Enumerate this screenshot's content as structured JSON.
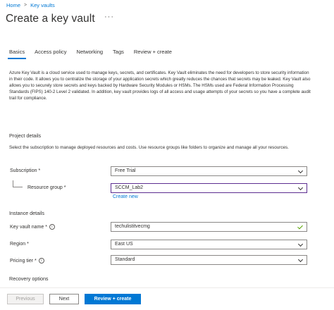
{
  "breadcrumb": {
    "home": "Home",
    "separator": ">",
    "parent": "Key vaults"
  },
  "page": {
    "title": "Create a key vault",
    "more": "···"
  },
  "tabs": [
    {
      "label": "Basics",
      "active": true
    },
    {
      "label": "Access policy",
      "active": false
    },
    {
      "label": "Networking",
      "active": false
    },
    {
      "label": "Tags",
      "active": false
    },
    {
      "label": "Review + create",
      "active": false
    }
  ],
  "intro": "Azure Key Vault is a cloud service used to manage keys, secrets, and certificates. Key Vault eliminates the need for developers to store security information in their code. It allows you to centralize the storage of your application secrets which greatly reduces the chances that secrets may be leaked. Key Vault also allows you to securely store secrets and keys backed by Hardware Security Modules or HSMs. The HSMs used are Federal Information Processing Standards (FIPS) 140-2 Level 2 validated. In addition, key vault provides logs of all access and usage attempts of your secrets so you have a complete audit trail for compliance.",
  "project": {
    "heading": "Project details",
    "description": "Select the subscription to manage deployed resources and costs. Use resource groups like folders to organize and manage all your resources.",
    "subscription": {
      "label": "Subscription *",
      "value": "Free Trial"
    },
    "resource_group": {
      "label": "Resource group *",
      "value": "SCCM_Lab2",
      "create_new": "Create new"
    }
  },
  "instance": {
    "heading": "Instance details",
    "name": {
      "label": "Key vault name *",
      "value": "techulistitvecmg"
    },
    "region": {
      "label": "Region *",
      "value": "East US"
    },
    "pricing": {
      "label": "Pricing tier *",
      "value": "Standard"
    }
  },
  "recovery": {
    "heading": "Recovery options"
  },
  "footer": {
    "previous": "Previous",
    "next": "Next",
    "review": "Review + create"
  },
  "colors": {
    "accent": "#0078d4",
    "focus_border": "#5c2d91",
    "valid_check": "#57a300"
  }
}
